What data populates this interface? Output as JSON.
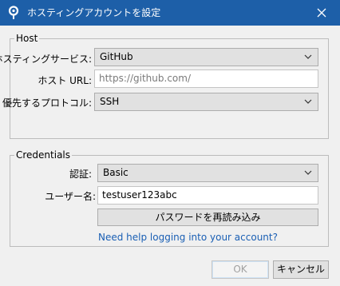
{
  "window": {
    "title": "ホスティングアカウントを設定"
  },
  "host": {
    "legend": "Host",
    "service_label": "ホスティングサービス:",
    "service_value": "GitHub",
    "url_label": "ホスト URL:",
    "url_placeholder": "https://github.com/",
    "protocol_label": "優先するプロトコル:",
    "protocol_value": "SSH"
  },
  "credentials": {
    "legend": "Credentials",
    "auth_label": "認証:",
    "auth_value": "Basic",
    "username_label": "ユーザー名:",
    "username_value": "testuser123abc",
    "reload_password_label": "パスワードを再読み込み",
    "help_link": "Need help logging into your account?"
  },
  "footer": {
    "ok_label": "OK",
    "cancel_label": "キャンセル"
  },
  "colors": {
    "titlebar": "#1d5fa8",
    "link": "#1a5fb4",
    "dialog_bg": "#f0f0f0"
  },
  "icons": {
    "app": "sourcetree-logo-icon",
    "close": "close-icon",
    "dropdown": "chevron-down-icon"
  }
}
